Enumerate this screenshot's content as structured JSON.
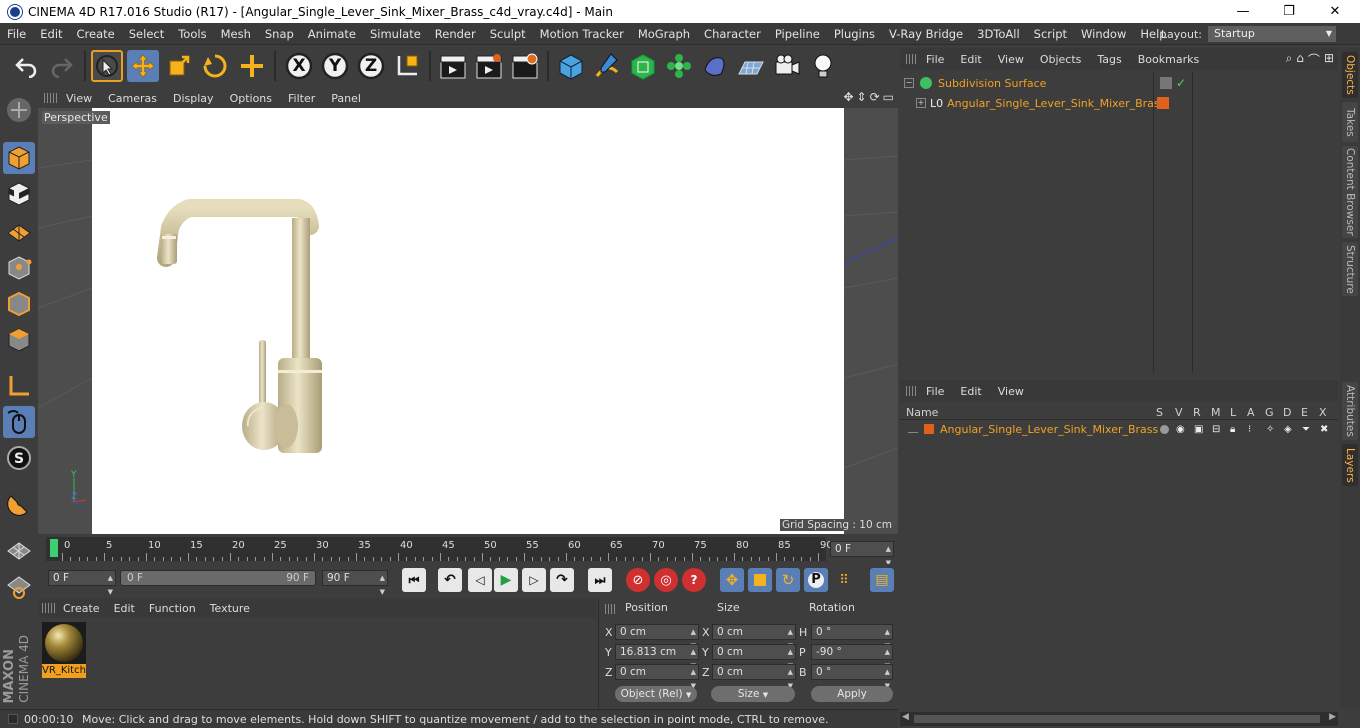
{
  "window": {
    "title": "CINEMA 4D R17.016 Studio (R17) - [Angular_Single_Lever_Sink_Mixer_Brass_c4d_vray.c4d] - Main",
    "min": "—",
    "max": "❐",
    "close": "✕"
  },
  "menubar": {
    "items": [
      "File",
      "Edit",
      "Create",
      "Select",
      "Tools",
      "Mesh",
      "Snap",
      "Animate",
      "Simulate",
      "Render",
      "Sculpt",
      "Motion Tracker",
      "MoGraph",
      "Character",
      "Pipeline",
      "Plugins",
      "V-Ray Bridge",
      "3DToAll",
      "Script",
      "Window",
      "Help"
    ],
    "layout_label": "Layout:",
    "layout_value": "Startup"
  },
  "toolbar": {
    "x_label": "X",
    "y_label": "Y",
    "z_label": "Z"
  },
  "viewport": {
    "menu": [
      "View",
      "Cameras",
      "Display",
      "Options",
      "Filter",
      "Panel"
    ],
    "camera_label": "Perspective",
    "grid_spacing": "Grid Spacing : 10 cm",
    "axis_y": "Y",
    "axis_z": "Z"
  },
  "timeline": {
    "ticks": [
      "0",
      "5",
      "10",
      "15",
      "20",
      "25",
      "30",
      "35",
      "40",
      "45",
      "50",
      "55",
      "60",
      "65",
      "70",
      "75",
      "80",
      "85",
      "90"
    ],
    "current_frame": "0 F",
    "start_field": "0 F",
    "range_start": "0 F",
    "range_end": "90 F",
    "end_field": "90 F"
  },
  "material_manager": {
    "menu": [
      "Create",
      "Edit",
      "Function",
      "Texture"
    ],
    "material_name": "VR_Kitch"
  },
  "coordinates": {
    "headers": {
      "position": "Position",
      "size": "Size",
      "rotation": "Rotation"
    },
    "rows": [
      {
        "axis": "X",
        "pos": "0 cm",
        "size_axis": "X",
        "size": "0 cm",
        "rot_axis": "H",
        "rot": "0 °"
      },
      {
        "axis": "Y",
        "pos": "16.813 cm",
        "size_axis": "Y",
        "size": "0 cm",
        "rot_axis": "P",
        "rot": "-90 °"
      },
      {
        "axis": "Z",
        "pos": "0 cm",
        "size_axis": "Z",
        "size": "0 cm",
        "rot_axis": "B",
        "rot": "0 °"
      }
    ],
    "mode_select": "Object (Rel)",
    "size_select": "Size",
    "apply_label": "Apply"
  },
  "status": {
    "time": "00:00:10",
    "message": "Move: Click and drag to move elements. Hold down SHIFT to quantize movement / add to the selection in point mode, CTRL to remove."
  },
  "objects_panel": {
    "menu": [
      "File",
      "Edit",
      "View",
      "Objects",
      "Tags",
      "Bookmarks"
    ],
    "items": [
      {
        "name": "Subdivision Surface"
      },
      {
        "name": "Angular_Single_Lever_Sink_Mixer_Brass"
      }
    ]
  },
  "layers_panel": {
    "menu": [
      "File",
      "Edit",
      "View"
    ],
    "columns": [
      "Name",
      "S",
      "V",
      "R",
      "M",
      "L",
      "A",
      "G",
      "D",
      "E",
      "X"
    ],
    "rows": [
      {
        "name": "Angular_Single_Lever_Sink_Mixer_Brass"
      }
    ]
  },
  "right_tabs": [
    "Objects",
    "Takes",
    "Content Browser",
    "Structure",
    "Attributes",
    "Layers"
  ],
  "branding": {
    "maxon": "MAXON",
    "cinema": "CINEMA 4D"
  },
  "colors": {
    "accent": "#5a7fb7",
    "highlight_text": "#f0a020",
    "layer_orange": "#e0601e"
  }
}
